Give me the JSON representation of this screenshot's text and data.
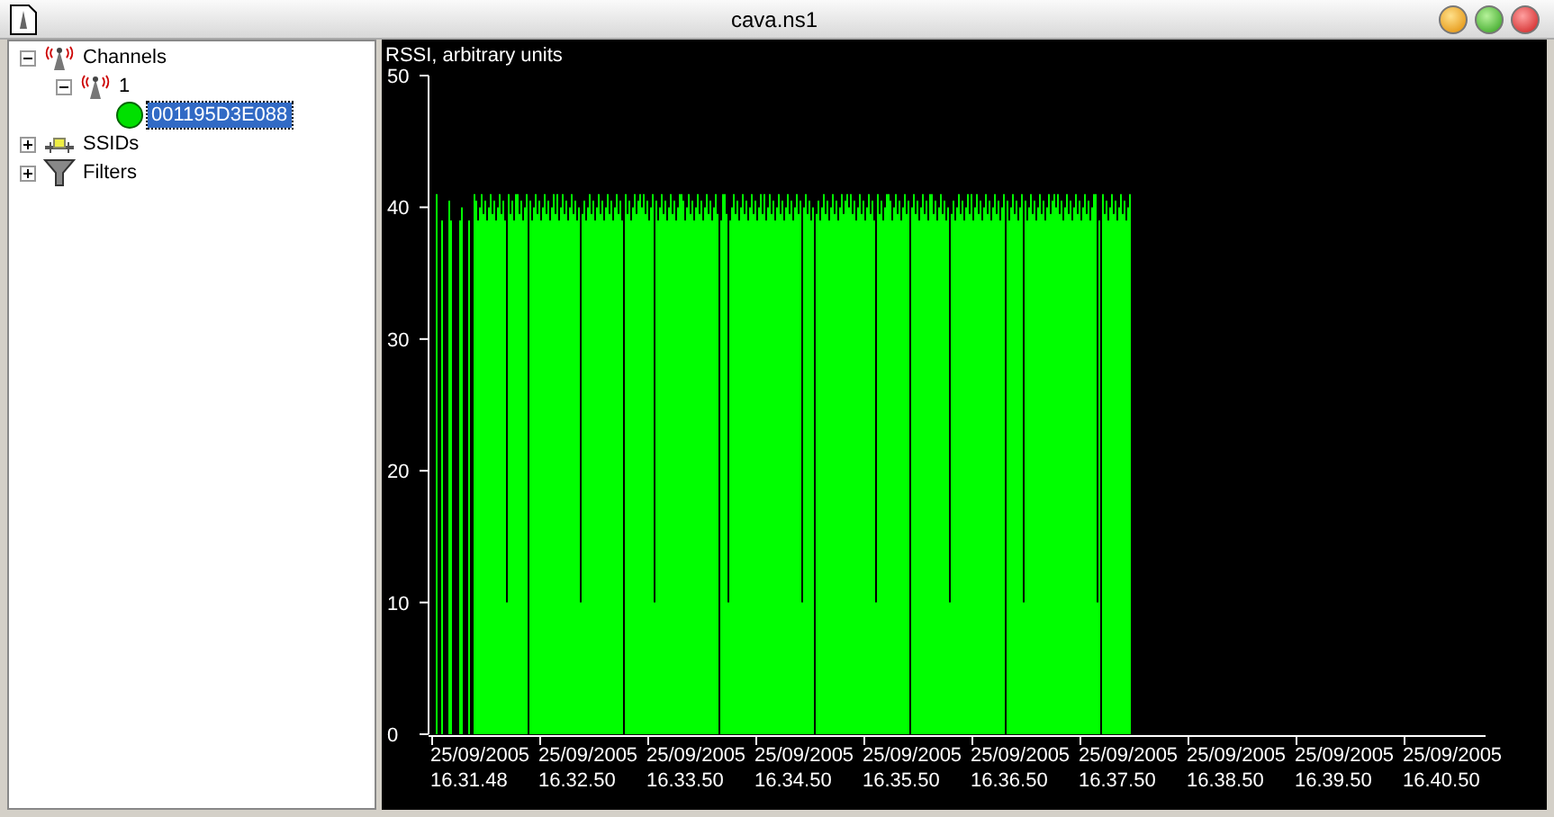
{
  "window": {
    "title": "cava.ns1"
  },
  "tree": [
    {
      "label": "Channels",
      "kind": "antenna",
      "expanded": true,
      "selected": false,
      "children": [
        {
          "label": "1",
          "kind": "antenna",
          "expanded": true,
          "selected": false,
          "children": [
            {
              "label": "001195D3E088",
              "kind": "dot",
              "selected": true
            }
          ]
        }
      ]
    },
    {
      "label": "SSIDs",
      "kind": "network",
      "expanded": false,
      "selected": false
    },
    {
      "label": "Filters",
      "kind": "filter",
      "expanded": false,
      "selected": false
    }
  ],
  "chart": {
    "ylabel": "RSSI, arbitrary units",
    "yticks": [
      "50",
      "40",
      "30",
      "20",
      "10",
      "0"
    ],
    "xticks": [
      {
        "date": "25/09/2005",
        "time": "16.31.48"
      },
      {
        "date": "25/09/2005",
        "time": "16.32.50"
      },
      {
        "date": "25/09/2005",
        "time": "16.33.50"
      },
      {
        "date": "25/09/2005",
        "time": "16.34.50"
      },
      {
        "date": "25/09/2005",
        "time": "16.35.50"
      },
      {
        "date": "25/09/2005",
        "time": "16.36.50"
      },
      {
        "date": "25/09/2005",
        "time": "16.37.50"
      },
      {
        "date": "25/09/2005",
        "time": "16.38.50"
      },
      {
        "date": "25/09/2005",
        "time": "16.39.50"
      },
      {
        "date": "25/09/2005",
        "time": "16.40.50"
      }
    ]
  }
}
